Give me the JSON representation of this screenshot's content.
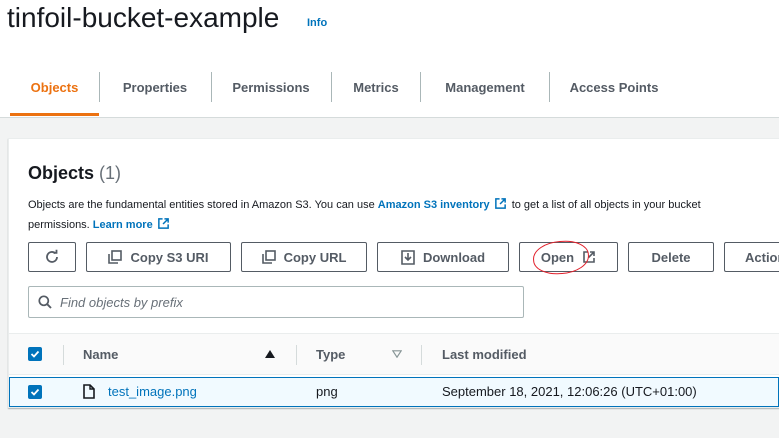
{
  "header": {
    "bucket_name": "tinfoil-bucket-example",
    "info_label": "Info"
  },
  "tabs": [
    {
      "label": "Objects",
      "active": true
    },
    {
      "label": "Properties"
    },
    {
      "label": "Permissions"
    },
    {
      "label": "Metrics"
    },
    {
      "label": "Management"
    },
    {
      "label": "Access Points"
    }
  ],
  "objects_panel": {
    "title": "Objects",
    "count": "(1)",
    "description_pre": "Objects are the fundamental entities stored in Amazon S3. You can use ",
    "inventory_link": "Amazon S3 inventory",
    "description_post": " to get a list of all objects in your bucket",
    "description_line2": "permissions. ",
    "learn_more_link": "Learn more"
  },
  "toolbar": {
    "copy_s3_uri": "Copy S3 URI",
    "copy_url": "Copy URL",
    "download": "Download",
    "open": "Open",
    "delete": "Delete",
    "actions": "Actions"
  },
  "search": {
    "placeholder": "Find objects by prefix",
    "value": ""
  },
  "table": {
    "columns": [
      "Name",
      "Type",
      "Last modified"
    ],
    "rows": [
      {
        "name": "test_image.png",
        "type": "png",
        "last_modified": "September 18, 2021, 12:06:26 (UTC+01:00)",
        "selected": true
      }
    ]
  },
  "colors": {
    "accent": "#ec7211",
    "link": "#0073bb",
    "annotation": "#e2202b"
  }
}
